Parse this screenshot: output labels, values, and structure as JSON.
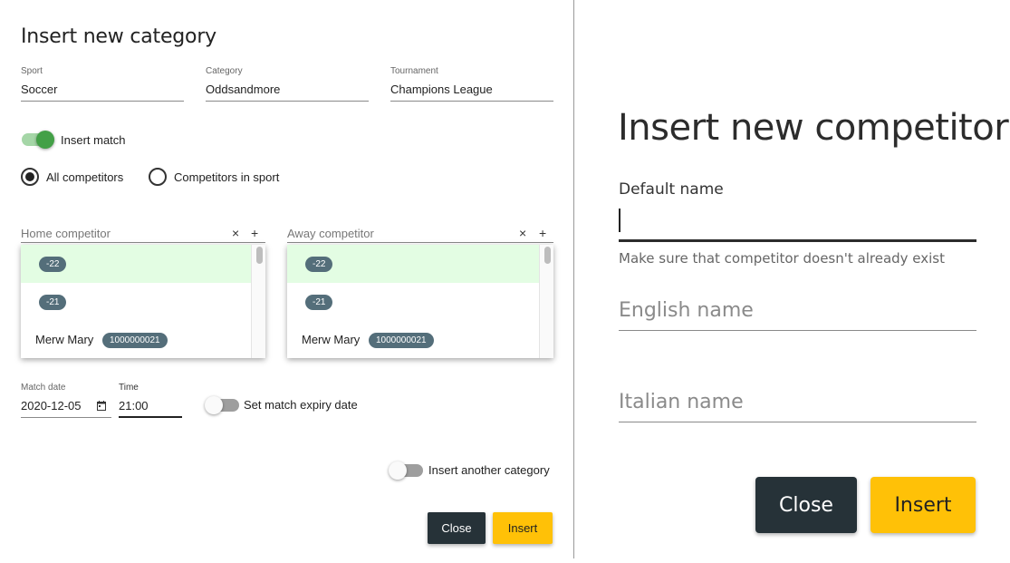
{
  "category_dialog": {
    "title": "Insert new category",
    "fields": {
      "sport": {
        "label": "Sport",
        "value": "Soccer"
      },
      "category": {
        "label": "Category",
        "value": "Oddsandmore"
      },
      "tournament": {
        "label": "Tournament",
        "value": "Champions League"
      }
    },
    "insert_match": {
      "label": "Insert match",
      "on": true
    },
    "radio": {
      "all_competitors": {
        "label": "All competitors",
        "checked": true
      },
      "competitors_in_sport": {
        "label": "Competitors in sport",
        "checked": false
      }
    },
    "home": {
      "placeholder": "Home competitor",
      "clear_icon": "×",
      "add_icon": "+",
      "items": [
        {
          "name": "",
          "badge": "-22",
          "selected": true
        },
        {
          "name": "",
          "badge": "-21",
          "selected": false
        },
        {
          "name": "Merw Mary",
          "badge": "1000000021",
          "selected": false
        }
      ]
    },
    "away": {
      "placeholder": "Away competitor",
      "clear_icon": "×",
      "add_icon": "+",
      "items": [
        {
          "name": "",
          "badge": "-22",
          "selected": true
        },
        {
          "name": "",
          "badge": "-21",
          "selected": false
        },
        {
          "name": "Merw Mary",
          "badge": "1000000021",
          "selected": false
        }
      ]
    },
    "match_date": {
      "label": "Match date",
      "value": "2020-12-05"
    },
    "time": {
      "label": "Time",
      "value": "21:00"
    },
    "expiry": {
      "label": "Set match expiry date",
      "on": false
    },
    "another": {
      "label": "Insert another category",
      "on": false
    },
    "close_label": "Close",
    "insert_label": "Insert"
  },
  "competitor_dialog": {
    "title": "Insert new competitor",
    "default_name": {
      "label": "Default name",
      "value": "",
      "hint": "Make sure that competitor doesn't already exist"
    },
    "english_name": {
      "placeholder": "English name"
    },
    "italian_name": {
      "placeholder": "Italian name"
    },
    "close_label": "Close",
    "insert_label": "Insert"
  },
  "colors": {
    "dark_button": "#263238",
    "yellow_button": "#ffc107",
    "toggle_on": "#43a047",
    "badge": "#546e7a",
    "selected_row": "#e3fde3"
  }
}
